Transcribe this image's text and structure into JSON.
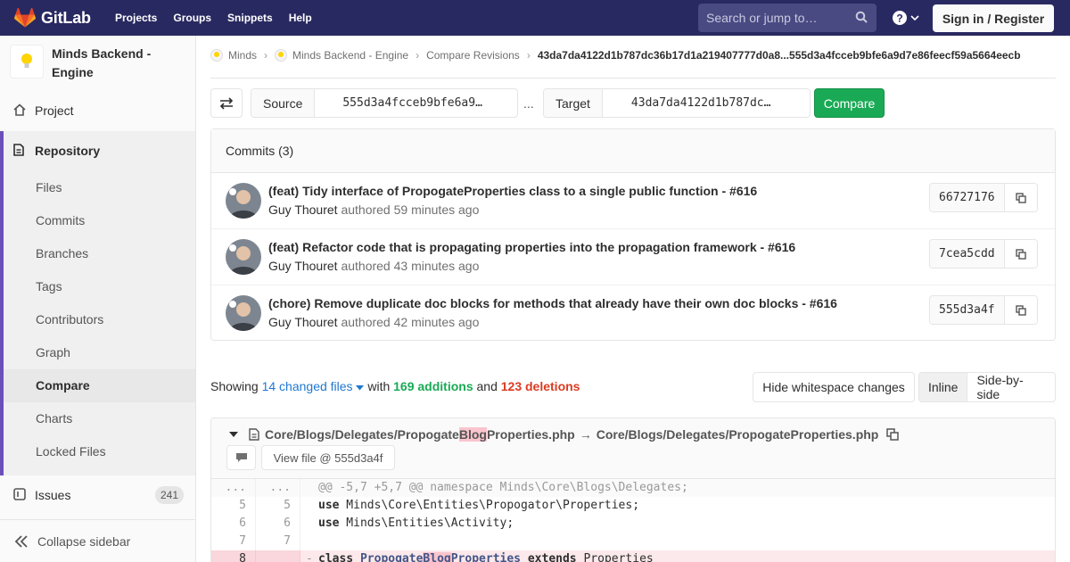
{
  "topbar": {
    "brand": "GitLab",
    "nav": [
      "Projects",
      "Groups",
      "Snippets",
      "Help"
    ],
    "search_placeholder": "Search or jump to…",
    "signin": "Sign in / Register",
    "colors": {
      "bar": "#292961",
      "logo": "#fc6d26"
    }
  },
  "sidebar": {
    "project_name": "Minds Backend - Engine",
    "project": "Project",
    "repository": "Repository",
    "repo_items": [
      "Files",
      "Commits",
      "Branches",
      "Tags",
      "Contributors",
      "Graph",
      "Compare",
      "Charts",
      "Locked Files"
    ],
    "active_item": "Compare",
    "issues": "Issues",
    "issues_count": "241",
    "collapse": "Collapse sidebar"
  },
  "breadcrumb": {
    "items": [
      "Minds",
      "Minds Backend - Engine",
      "Compare Revisions"
    ],
    "current": "43da7da4122d1b787dc36b17d1a219407777d0a8...555d3a4fcceb9bfe6a9d7e86feecf59a5664eecb"
  },
  "compare": {
    "source_label": "Source",
    "source_value": "555d3a4fcceb9bfe6a9…",
    "dots": "...",
    "target_label": "Target",
    "target_value": "43da7da4122d1b787dc…",
    "button": "Compare"
  },
  "commits": {
    "header": "Commits (3)",
    "authored": "authored",
    "rows": [
      {
        "title": "(feat) Tidy interface of PropogateProperties class to a single public function - #616",
        "author": "Guy Thouret",
        "time": "59 minutes ago",
        "sha": "66727176"
      },
      {
        "title": "(feat) Refactor code that is propagating properties into the propagation framework - #616",
        "author": "Guy Thouret",
        "time": "43 minutes ago",
        "sha": "7cea5cdd"
      },
      {
        "title": "(chore) Remove duplicate doc blocks for methods that already have their own doc blocks - #616",
        "author": "Guy Thouret",
        "time": "42 minutes ago",
        "sha": "555d3a4f"
      }
    ]
  },
  "summary": {
    "showing": "Showing",
    "files": "14 changed files",
    "with": "with",
    "additions": "169 additions",
    "and": "and",
    "deletions": "123 deletions"
  },
  "view": {
    "whitespace": "Hide whitespace changes",
    "inline": "Inline",
    "side_by_side": "Side-by-side"
  },
  "file": {
    "old_path_pre": "Core/Blogs/Delegates/Propogate",
    "old_path_hl": "Blog",
    "old_path_post": "Properties.php",
    "arrow": "→",
    "new_path": "Core/Blogs/Delegates/PropogateProperties.php",
    "view_file": "View file @ 555d3a4f"
  },
  "diff": {
    "hunk_old": "...",
    "hunk_new": "...",
    "hunk": "@@ -5,7 +5,7 @@ namespace Minds\\Core\\Blogs\\Delegates;",
    "lines": [
      {
        "old": "5",
        "new": "5",
        "kw": "use",
        "rest": " Minds\\Core\\Entities\\Propogator\\Properties;"
      },
      {
        "old": "6",
        "new": "6",
        "kw": "use",
        "rest": " Minds\\Entities\\Activity;"
      },
      {
        "old": "7",
        "new": "7",
        "kw": "",
        "rest": ""
      }
    ],
    "removed": {
      "old": "8",
      "sign": "-",
      "kw": "class",
      "cls_pre": "Propogate",
      "cls_hl": "Blog",
      "cls_post": "Properties",
      "ext": "extends",
      "rest": " Properties"
    }
  }
}
